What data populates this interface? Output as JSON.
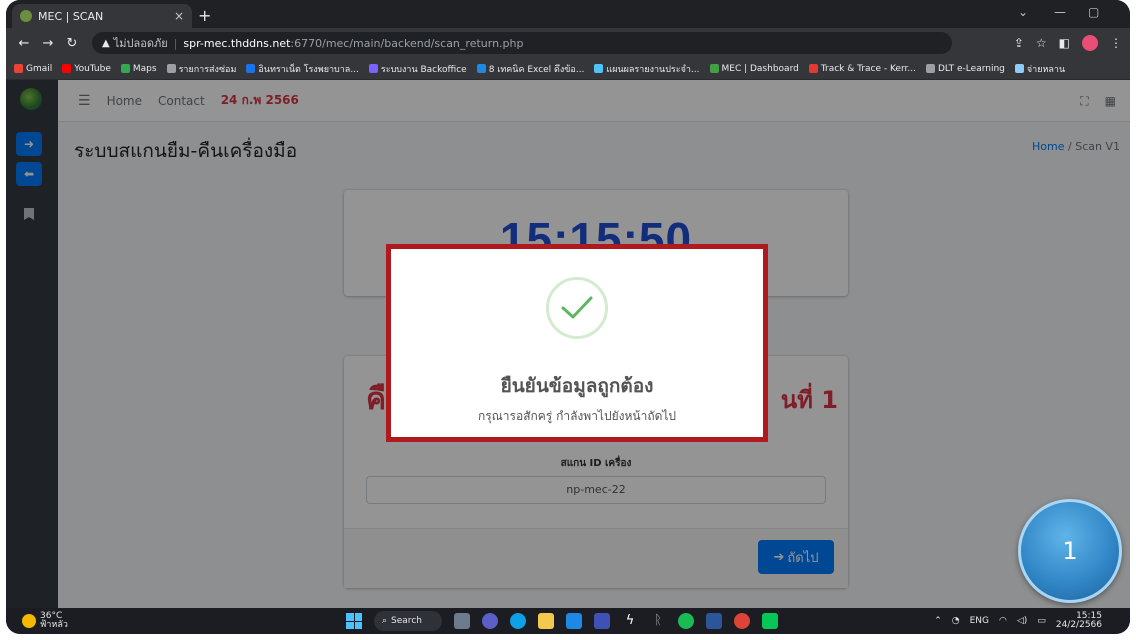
{
  "browser": {
    "tab_title": "MEC | SCAN",
    "tab_close": "×",
    "new_tab": "+",
    "security_label": "ไม่ปลอดภัย",
    "url_host": "spr-mec.thddns.net",
    "url_path": ":6770/mec/main/backend/scan_return.php"
  },
  "bookmarks": [
    {
      "label": "Gmail",
      "color": "#ea4335"
    },
    {
      "label": "YouTube",
      "color": "#ff0000"
    },
    {
      "label": "Maps",
      "color": "#34a853"
    },
    {
      "label": "รายการส่งซ่อม",
      "color": "#9aa0a6"
    },
    {
      "label": "อินทราเน็ต โรงพยาบาล...",
      "color": "#1a73e8"
    },
    {
      "label": "ระบบงาน Backoffice",
      "color": "#7b61ff"
    },
    {
      "label": "8 เทคนิค Excel ดึงข้อ...",
      "color": "#1e88e5"
    },
    {
      "label": "แผนผลรายงานประจำ...",
      "color": "#4fc3f7"
    },
    {
      "label": "MEC | Dashboard",
      "color": "#43a047"
    },
    {
      "label": "Track & Trace - Kerr...",
      "color": "#e53935"
    },
    {
      "label": "DLT e-Learning",
      "color": "#9aa0a6"
    },
    {
      "label": "จ่ายหลาน",
      "color": "#90caf9"
    }
  ],
  "topnav": {
    "home": "Home",
    "contact": "Contact",
    "date": "24 ก.พ 2566"
  },
  "page": {
    "title": "ระบบสแกนยืม-คืนเครื่องมือ",
    "breadcrumb_home": "Home",
    "breadcrumb_sep": "/",
    "breadcrumb_current": "Scan V1"
  },
  "clock": "15:15:50",
  "scan_card": {
    "heading_left": "คื",
    "heading_right": "นที่ 1",
    "label": "สแกน ID เครื่อง",
    "value": "np-mec-22",
    "next_button": "ถัดไป"
  },
  "modal": {
    "title": "ยืนยันข้อมูลถูกต้อง",
    "message": "กรุณารอสักครู่ กำลังพาไปยังหน้าถัดไป"
  },
  "step_badge": "1",
  "taskbar": {
    "temperature": "36°C",
    "weather_text": "ฟ้าหลัว",
    "search": "Search",
    "lang": "ENG",
    "time": "15:15",
    "date": "24/2/2566"
  },
  "colors": {
    "accent": "#007bff",
    "danger": "#dc3545",
    "clock": "#1e4fd6",
    "modal_border": "#b0191e",
    "success": "#5cb85c"
  }
}
